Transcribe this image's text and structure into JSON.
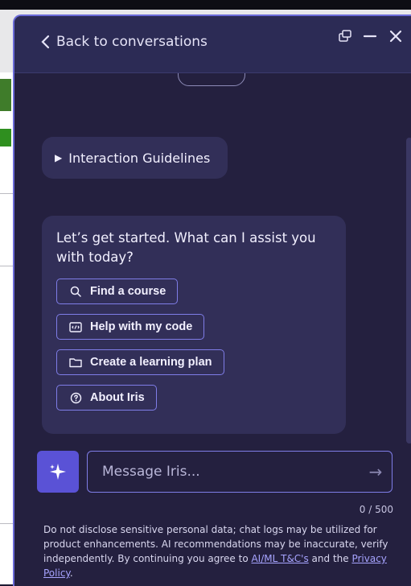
{
  "header": {
    "back_label": "Back to conversations"
  },
  "guidelines": {
    "label": "Interaction Guidelines"
  },
  "assistant": {
    "prompt": "Let’s get started. What can I assist you with today?",
    "chips": [
      {
        "label": "Find a course",
        "icon": "search-icon"
      },
      {
        "label": "Help with my code",
        "icon": "code-icon"
      },
      {
        "label": "Create a learning plan",
        "icon": "folder-icon"
      },
      {
        "label": "About Iris",
        "icon": "help-circle-icon"
      }
    ]
  },
  "composer": {
    "placeholder": "Message Iris...",
    "counter": "0 / 500"
  },
  "disclaimer": {
    "text": "Do not disclose sensitive personal data; chat logs may be utilized for product enhancements. AI recommendations may be inaccurate, verify independently. By continuing you agree to ",
    "link1": "AI/ML T&C's",
    "middle": " and the ",
    "link2": "Privacy Policy",
    "end": "."
  },
  "colors": {
    "panel_bg": "#24203f",
    "header_bg": "#2c2b55",
    "accent": "#7f7de7",
    "button_bg": "#5a52d6"
  }
}
